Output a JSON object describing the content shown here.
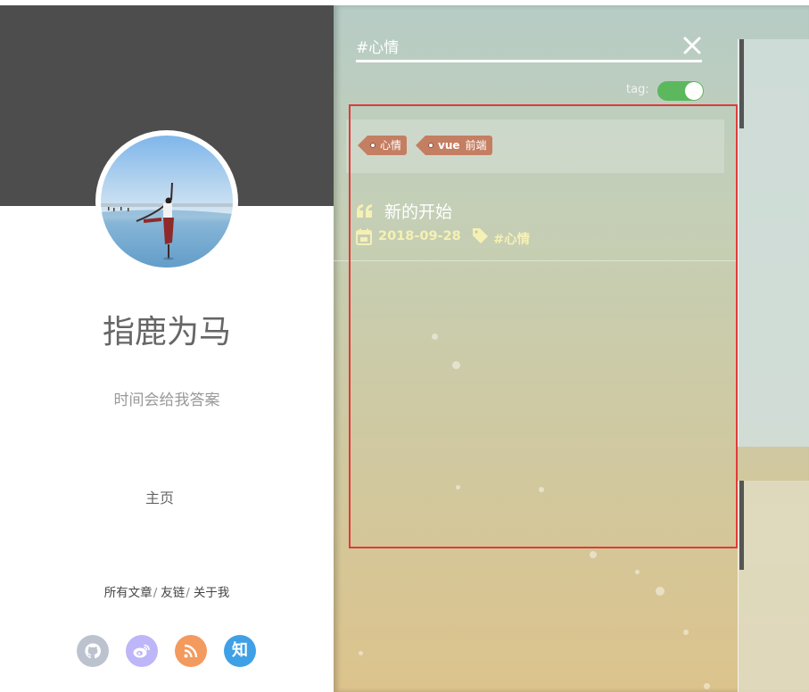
{
  "sidebar": {
    "blog_title": "指鹿为马",
    "motto": "时间会给我答案",
    "nav_home": "主页",
    "nav_links": [
      "所有文章",
      "友链",
      "关于我"
    ],
    "link_separator": "/",
    "social": [
      {
        "name": "github-icon",
        "color": "#bcc3cf"
      },
      {
        "name": "weibo-icon",
        "color": "#bdb6f8"
      },
      {
        "name": "rss-icon",
        "color": "#f39a5e"
      },
      {
        "name": "zhihu-icon",
        "color": "#3fa0e6",
        "glyph": "知"
      }
    ]
  },
  "search": {
    "query": "#心情"
  },
  "tag_toggle": {
    "label": "tag:",
    "on": true
  },
  "tags": [
    {
      "label": "心情"
    },
    {
      "label_bold": "vue",
      "label": "前端"
    }
  ],
  "posts": [
    {
      "title": "新的开始",
      "date": "2018-09-28",
      "tag": "#心情"
    }
  ],
  "colors": {
    "sidebar_header": "#4d4d4d",
    "tag_chip": "#c47e62",
    "toggle_on": "#5cb85c",
    "post_meta": "#f5f1b5",
    "highlight": "#e03a3a"
  }
}
